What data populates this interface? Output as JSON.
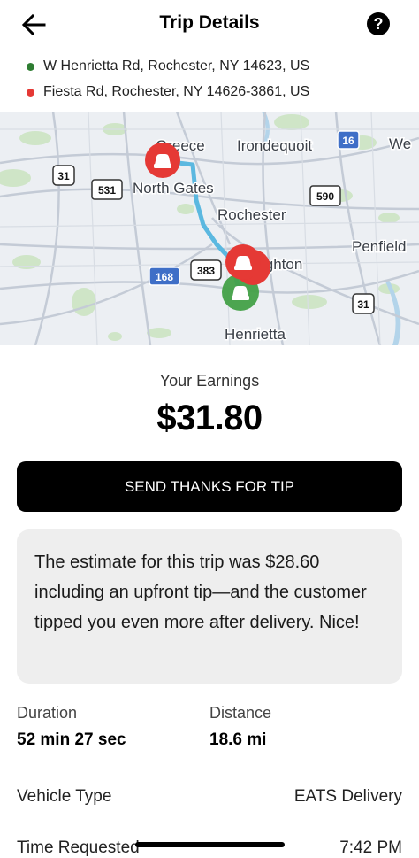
{
  "header": {
    "title": "Trip Details",
    "back_icon": "arrow-left-icon",
    "help_icon": "question-circle-icon",
    "help_glyph": "?"
  },
  "addresses": {
    "pickup": {
      "text": "W Henrietta Rd, Rochester, NY 14623, US",
      "color": "#2e7d32"
    },
    "dropoff": {
      "text": "Fiesta Rd, Rochester, NY 14626-3861, US",
      "color": "#e53935"
    }
  },
  "map": {
    "labels": {
      "greece": "Greece",
      "irondequoit": "Irondequoit",
      "webster": "We",
      "north_gates": "North Gates",
      "rochester": "Rochester",
      "penfield": "Penfield",
      "brighton": "ighton",
      "henrietta": "Henrietta"
    },
    "shields": {
      "s16": "16",
      "s31a": "31",
      "s531": "531",
      "s590": "590",
      "s383": "383",
      "s168": "168",
      "s31b": "31"
    },
    "route_color": "#5bb8e0"
  },
  "earnings": {
    "label": "Your Earnings",
    "amount": "$31.80"
  },
  "tip_button": {
    "label": "SEND THANKS FOR TIP"
  },
  "note": {
    "text": "The estimate for this trip was $28.60 including an upfront tip—and the customer tipped you even more after delivery. Nice!"
  },
  "stats": {
    "duration_label": "Duration",
    "duration_value": "52 min 27 sec",
    "distance_label": "Distance",
    "distance_value": "18.6 mi"
  },
  "details": {
    "vehicle_label": "Vehicle Type",
    "vehicle_value": "EATS Delivery",
    "time_label": "Time Requested",
    "time_value": "7:42 PM"
  }
}
